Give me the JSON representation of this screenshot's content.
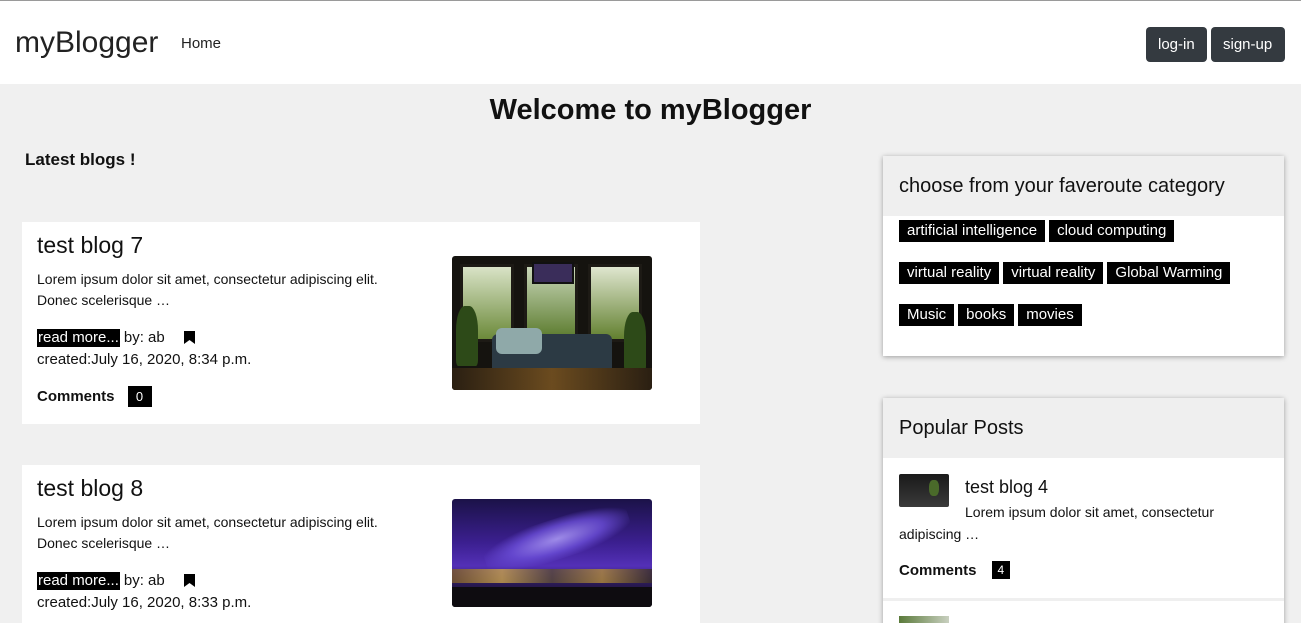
{
  "navbar": {
    "brand": "myBlogger",
    "home_label": "Home",
    "login_label": "log-in",
    "signup_label": "sign-up"
  },
  "main": {
    "welcome": "Welcome to myBlogger",
    "latest_heading": "Latest blogs !",
    "posts": [
      {
        "title": "test blog 7",
        "excerpt": "Lorem ipsum dolor sit amet, consectetur adipiscing elit. Donec scelerisque …",
        "read_more": "read more...",
        "by": "by: ab",
        "created": "created:July 16, 2020, 8:34 p.m.",
        "comments_label": "Comments",
        "comments_count": "0",
        "image": "living-room-photo"
      },
      {
        "title": "test blog 8",
        "excerpt": "Lorem ipsum dolor sit amet, consectetur adipiscing elit. Donec scelerisque …",
        "read_more": "read more...",
        "by": "by: ab",
        "created": "created:July 16, 2020, 8:33 p.m.",
        "image": "night-sky-photo"
      }
    ]
  },
  "sidebar": {
    "category_heading": "choose from your faveroute category",
    "categories": [
      [
        "artificial intelligence",
        "cloud computing"
      ],
      [
        "virtual reality",
        "virtual reality",
        "Global Warming"
      ],
      [
        "Music",
        "books",
        "movies"
      ]
    ],
    "popular_heading": "Popular Posts",
    "popular": [
      {
        "title": "test blog 4",
        "excerpt": "Lorem ipsum dolor sit amet, consectetur adipiscing …",
        "comments_label": "Comments",
        "comments_count": "4"
      }
    ]
  },
  "icons": {
    "bookmark": "bookmark-icon"
  }
}
